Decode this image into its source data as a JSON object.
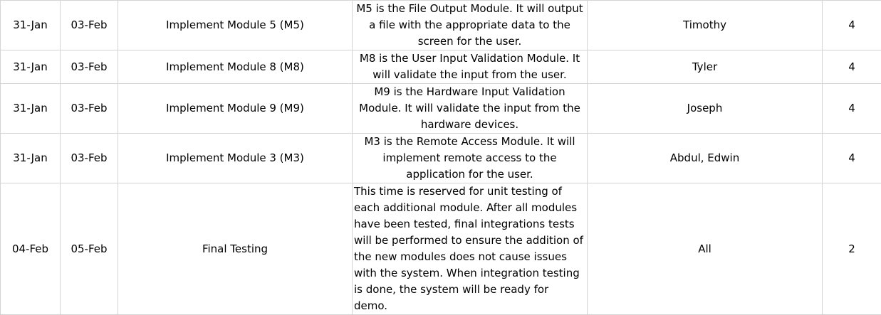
{
  "rows": [
    {
      "start": "31-Jan",
      "end": "03-Feb",
      "task": "Implement Module 5 (M5)",
      "description": "M5 is the File Output Module. It will output a file with the appropriate data to the screen for the user.",
      "assignee": "Timothy",
      "days": "4"
    },
    {
      "start": "31-Jan",
      "end": "03-Feb",
      "task": "Implement Module 8 (M8)",
      "description": "M8 is the User Input Validation Module. It will validate the input from the user.",
      "assignee": "Tyler",
      "days": "4"
    },
    {
      "start": "31-Jan",
      "end": "03-Feb",
      "task": "Implement Module 9 (M9)",
      "description": "M9 is the Hardware Input Validation Module. It will validate the input from the hardware devices.",
      "assignee": "Joseph",
      "days": "4"
    },
    {
      "start": "31-Jan",
      "end": "03-Feb",
      "task": "Implement Module 3 (M3)",
      "description": "M3 is the Remote Access Module. It will implement remote access to the application for the user.",
      "assignee": "Abdul, Edwin",
      "days": "4"
    },
    {
      "start": "04-Feb",
      "end": "05-Feb",
      "task": "Final Testing",
      "description": "This time is reserved for unit testing of each additional module. After all modules have been tested, final integrations tests will be performed to ensure the addition of the new modules does not cause issues with the system. When integration testing is done, the system will be ready for demo.",
      "assignee": "All",
      "days": "2"
    }
  ]
}
